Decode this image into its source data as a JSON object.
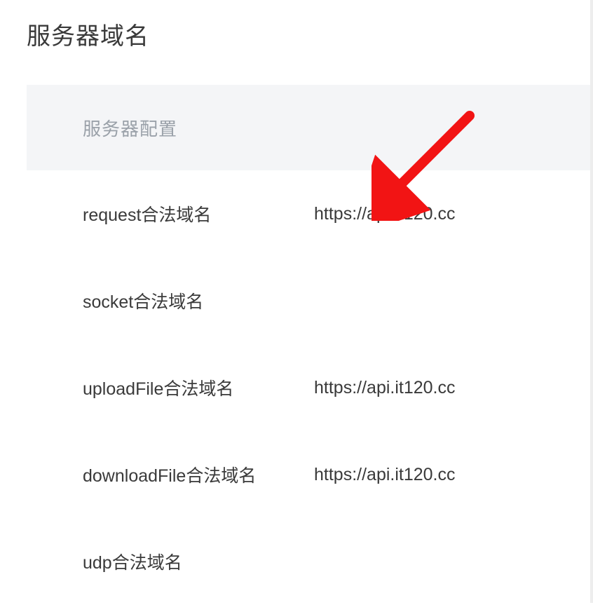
{
  "page_title": "服务器域名",
  "panel": {
    "header_label": "服务器配置"
  },
  "rows": [
    {
      "label": "request合法域名",
      "value": "https://api.it120.cc"
    },
    {
      "label": "socket合法域名",
      "value": ""
    },
    {
      "label": "uploadFile合法域名",
      "value": "https://api.it120.cc"
    },
    {
      "label": "downloadFile合法域名",
      "value": "https://api.it120.cc"
    },
    {
      "label": "udp合法域名",
      "value": ""
    }
  ],
  "annotation_arrow": {
    "color": "#f21414"
  }
}
